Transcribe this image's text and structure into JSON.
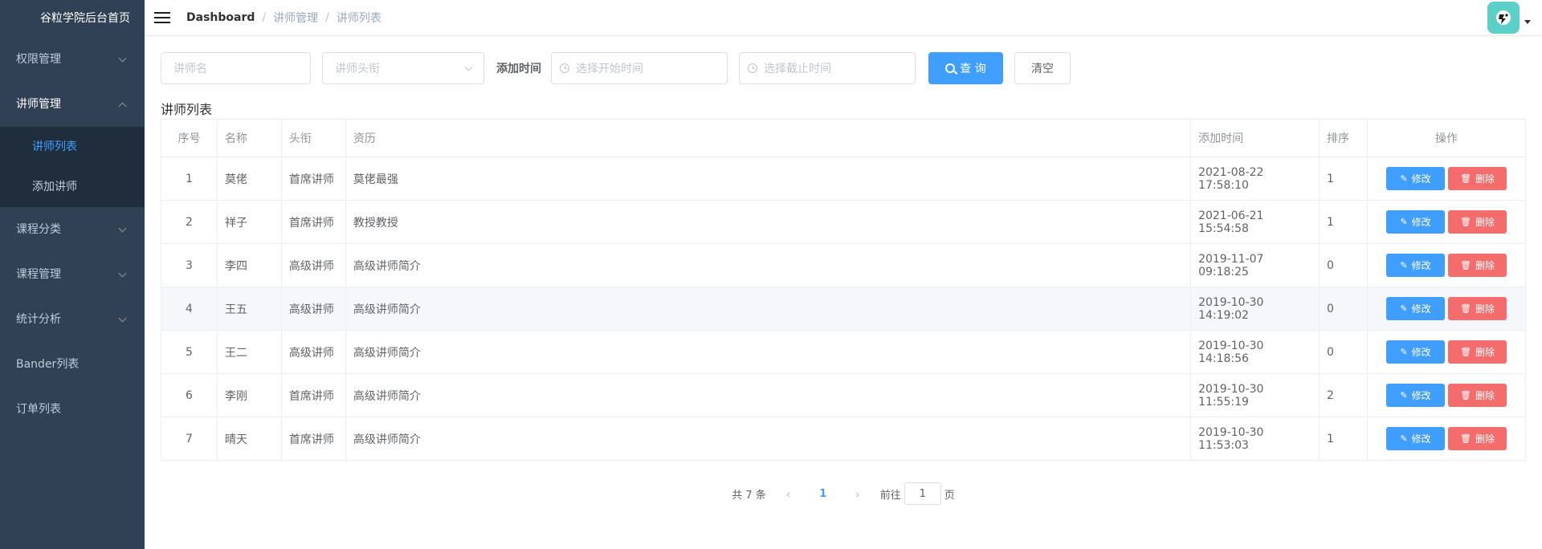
{
  "sidebar": {
    "title": "谷粒学院后台首页",
    "menus": [
      {
        "label": "权限管理"
      },
      {
        "label": "讲师管理"
      },
      {
        "label": "课程分类"
      },
      {
        "label": "课程管理"
      },
      {
        "label": "统计分析"
      },
      {
        "label": "Bander列表"
      },
      {
        "label": "订单列表"
      }
    ],
    "submenu": [
      {
        "label": "讲师列表"
      },
      {
        "label": "添加讲师"
      }
    ]
  },
  "breadcrumb": [
    "Dashboard",
    "讲师管理",
    "讲师列表"
  ],
  "search": {
    "name_placeholder": "讲师名",
    "level_placeholder": "讲师头衔",
    "time_label": "添加时间",
    "start_placeholder": "选择开始时间",
    "end_placeholder": "选择截止时间",
    "query_label": "查 询",
    "clear_label": "清空"
  },
  "list_title": "讲师列表",
  "table": {
    "headers": [
      "序号",
      "名称",
      "头衔",
      "资历",
      "添加时间",
      "排序",
      "操作"
    ],
    "edit_label": "修改",
    "delete_label": "删除",
    "rows": [
      {
        "idx": "1",
        "name": "莫佬",
        "level": "首席讲师",
        "intro": "莫佬最强",
        "time": "2021-08-22 17:58:10",
        "sort": "1"
      },
      {
        "idx": "2",
        "name": "祥子",
        "level": "首席讲师",
        "intro": "教授教授",
        "time": "2021-06-21 15:54:58",
        "sort": "1"
      },
      {
        "idx": "3",
        "name": "李四",
        "level": "高级讲师",
        "intro": "高级讲师简介",
        "time": "2019-11-07 09:18:25",
        "sort": "0"
      },
      {
        "idx": "4",
        "name": "王五",
        "level": "高级讲师",
        "intro": "高级讲师简介",
        "time": "2019-10-30 14:19:02",
        "sort": "0"
      },
      {
        "idx": "5",
        "name": "王二",
        "level": "高级讲师",
        "intro": "高级讲师简介",
        "time": "2019-10-30 14:18:56",
        "sort": "0"
      },
      {
        "idx": "6",
        "name": "李刚",
        "level": "首席讲师",
        "intro": "高级讲师简介",
        "time": "2019-10-30 11:55:19",
        "sort": "2"
      },
      {
        "idx": "7",
        "name": "晴天",
        "level": "首席讲师",
        "intro": "高级讲师简介",
        "time": "2019-10-30 11:53:03",
        "sort": "1"
      }
    ]
  },
  "pagination": {
    "total": "共 7 条",
    "current": "1",
    "goto_prefix": "前往",
    "goto_value": "1",
    "goto_suffix": "页"
  },
  "colors": {
    "sidebar_bg": "#304156",
    "submenu_bg": "#1f2d3d",
    "primary": "#409eff",
    "danger": "#f56c6c",
    "avatar_bg": "#5bcfc8"
  },
  "icons": {
    "menu_toggle": "hamburger-icon",
    "query": "search-icon",
    "date": "clock-icon",
    "edit": "edit-icon",
    "delete": "trash-icon",
    "avatar": "avatar-icon"
  }
}
